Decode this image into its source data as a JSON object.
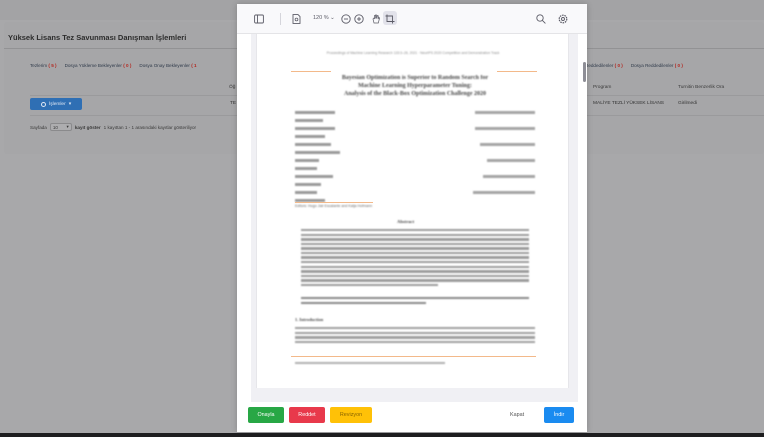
{
  "page": {
    "title": "Yüksek Lisans Tez Savunması Danışman İşlemleri",
    "tabs_left": [
      {
        "label": "Tezlerim",
        "count": "( 5 )"
      },
      {
        "label": "Dosya Yükleme Bekleyenler",
        "count": "( 0 )"
      },
      {
        "label": "Dosya Onay Bekleyenler",
        "count": "( 1"
      }
    ],
    "tabs_right": [
      {
        "label": "Reddedilenler",
        "count": "( 0 )"
      },
      {
        "label": "Dosya Reddedilenler",
        "count": "( 0 )"
      }
    ],
    "table": {
      "header_center": "Öğ",
      "header_program": "Program",
      "header_turnitin": "Turnitin Benzerlik Ora",
      "row": {
        "col_center": "TE",
        "program": "MALİYE TEZLİ YÜKSEK LİSANS",
        "turnitin": "Girilmedi"
      }
    },
    "actions_button": "İşlemler",
    "paging": {
      "prefix": "Sayfada",
      "page_size": "10",
      "suffix": "kayıt göster",
      "info": "1 kayıttan 1 - 1 arasındaki kayıtlar gösteriliyor"
    }
  },
  "modal": {
    "toolbar": {
      "zoom": "120 %",
      "icons": [
        "sidebar-toggle-icon",
        "page-icon",
        "zoom-out-icon",
        "zoom-in-icon",
        "hand-tool-icon",
        "crop-icon",
        "search-icon",
        "settings-icon"
      ]
    },
    "pdf": {
      "title_lines": [
        "Bayesian Optimization is Superior to Random Search for",
        "Machine Learning Hyperparameter Tuning:",
        "Analysis of the Black-Box Optimization Challenge 2020"
      ],
      "abstract_title": "Abstract",
      "section_title": "1. Introduction"
    },
    "buttons": {
      "approve": "Onayla",
      "reject": "Reddet",
      "revision": "Revizyon",
      "close": "Kapat",
      "download": "İndir"
    }
  },
  "colors": {
    "approve": "#28a745",
    "reject": "#e8394b",
    "revision": "#ffc107",
    "download": "#1a8bf0",
    "accent_blue": "#2f6fb4"
  }
}
